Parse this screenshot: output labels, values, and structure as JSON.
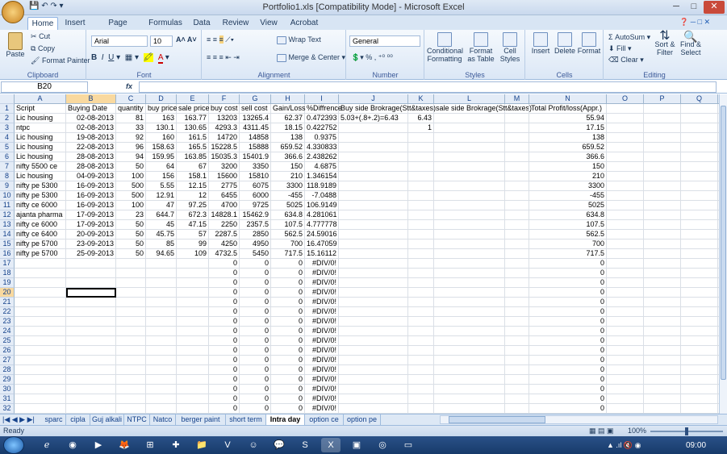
{
  "window": {
    "title": "Portfolio1.xls  [Compatibility Mode] - Microsoft Excel"
  },
  "ribbon": {
    "tabs": [
      "Home",
      "Insert",
      "Page Layout",
      "Formulas",
      "Data",
      "Review",
      "View",
      "Acrobat"
    ],
    "clipboard": {
      "label": "Clipboard",
      "paste": "Paste",
      "cut": "Cut",
      "copy": "Copy",
      "format_painter": "Format Painter"
    },
    "font": {
      "label": "Font",
      "name": "Arial",
      "size": "10"
    },
    "alignment": {
      "label": "Alignment",
      "wrap": "Wrap Text",
      "merge": "Merge & Center"
    },
    "number": {
      "label": "Number",
      "format": "General"
    },
    "styles": {
      "label": "Styles",
      "conditional": "Conditional Formatting",
      "format_table": "Format as Table",
      "cell_styles": "Cell Styles"
    },
    "cells": {
      "label": "Cells",
      "insert": "Insert",
      "delete": "Delete",
      "format": "Format"
    },
    "editing": {
      "label": "Editing",
      "autosum": "AutoSum",
      "fill": "Fill",
      "clear": "Clear",
      "sort": "Sort & Filter",
      "find": "Find & Select"
    }
  },
  "formula_bar": {
    "name_box": "B20",
    "formula": ""
  },
  "grid": {
    "columns": [
      "A",
      "B",
      "C",
      "D",
      "E",
      "F",
      "G",
      "H",
      "I",
      "J",
      "K",
      "L",
      "M",
      "N",
      "O",
      "P",
      "Q",
      "R"
    ],
    "rows": [
      [
        "Script",
        "Buying Date",
        "quantity",
        "buy price",
        "sale price",
        "buy cost",
        "sell cost",
        "Gain/Loss",
        "%Diffrence",
        "Buy side Brokrage(Stt&taxes)",
        "",
        "sale side Brokrage(Stt&taxes)",
        "",
        "Total Profit/loss(Appr.)"
      ],
      [
        "Lic housing",
        "02-08-2013",
        "81",
        "163",
        "163.77",
        "13203",
        "13265.4",
        "62.37",
        "0.472393",
        "5.03+(.8+.2)=6.43",
        "6.43",
        "",
        "",
        "55.94"
      ],
      [
        "ntpc",
        "02-08-2013",
        "33",
        "130.1",
        "130.65",
        "4293.3",
        "4311.45",
        "18.15",
        "0.422752",
        "",
        "1",
        "",
        "",
        "17.15"
      ],
      [
        "Lic housing",
        "19-08-2013",
        "92",
        "160",
        "161.5",
        "14720",
        "14858",
        "138",
        "0.9375",
        "",
        "",
        "",
        "",
        "138"
      ],
      [
        "Lic housing",
        "22-08-2013",
        "96",
        "158.63",
        "165.5",
        "15228.5",
        "15888",
        "659.52",
        "4.330833",
        "",
        "",
        "",
        "",
        "659.52"
      ],
      [
        "Lic housing",
        "28-08-2013",
        "94",
        "159.95",
        "163.85",
        "15035.3",
        "15401.9",
        "366.6",
        "2.438262",
        "",
        "",
        "",
        "",
        "366.6"
      ],
      [
        "nifty 5500 ce",
        "28-08-2013",
        "50",
        "64",
        "67",
        "3200",
        "3350",
        "150",
        "4.6875",
        "",
        "",
        "",
        "",
        "150"
      ],
      [
        "Lic housing",
        "04-09-2013",
        "100",
        "156",
        "158.1",
        "15600",
        "15810",
        "210",
        "1.346154",
        "",
        "",
        "",
        "",
        "210"
      ],
      [
        "nifty pe 5300",
        "16-09-2013",
        "500",
        "5.55",
        "12.15",
        "2775",
        "6075",
        "3300",
        "118.9189",
        "",
        "",
        "",
        "",
        "3300"
      ],
      [
        "nifty pe 5300",
        "16-09-2013",
        "500",
        "12.91",
        "12",
        "6455",
        "6000",
        "-455",
        "-7.0488",
        "",
        "",
        "",
        "",
        "-455"
      ],
      [
        "nifty ce 6000",
        "16-09-2013",
        "100",
        "47",
        "97.25",
        "4700",
        "9725",
        "5025",
        "106.9149",
        "",
        "",
        "",
        "",
        "5025"
      ],
      [
        "ajanta pharma",
        "17-09-2013",
        "23",
        "644.7",
        "672.3",
        "14828.1",
        "15462.9",
        "634.8",
        "4.281061",
        "",
        "",
        "",
        "",
        "634.8"
      ],
      [
        "nifty ce 6000",
        "17-09-2013",
        "50",
        "45",
        "47.15",
        "2250",
        "2357.5",
        "107.5",
        "4.777778",
        "",
        "",
        "",
        "",
        "107.5"
      ],
      [
        "nifty ce 6400",
        "20-09-2013",
        "50",
        "45.75",
        "57",
        "2287.5",
        "2850",
        "562.5",
        "24.59016",
        "",
        "",
        "",
        "",
        "562.5"
      ],
      [
        "nifty pe 5700",
        "23-09-2013",
        "50",
        "85",
        "99",
        "4250",
        "4950",
        "700",
        "16.47059",
        "",
        "",
        "",
        "",
        "700"
      ],
      [
        "nifty pe 5700",
        "25-09-2013",
        "50",
        "94.65",
        "109",
        "4732.5",
        "5450",
        "717.5",
        "15.16112",
        "",
        "",
        "",
        "",
        "717.5"
      ]
    ],
    "empty_row_values": {
      "buy_cost": "0",
      "sell_cost": "0",
      "gain": "0",
      "diff": "#DIV/0!",
      "total": "0"
    }
  },
  "sheets": [
    "sparc",
    "cipla",
    "Guj alkali",
    "NTPC",
    "Natco",
    "berger paint",
    "short term",
    "Intra day",
    "option ce",
    "option pe"
  ],
  "active_sheet": "Intra day",
  "status": {
    "left": "Ready",
    "zoom": "100%"
  },
  "taskbar": {
    "clock": "09:00"
  }
}
